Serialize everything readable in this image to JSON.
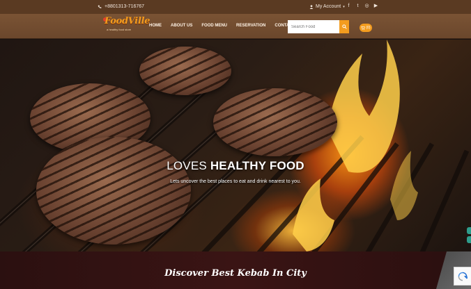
{
  "topbar": {
    "phone": "+8801313-716767",
    "account_label": "My Account",
    "socials": [
      "facebook-icon",
      "twitter-icon",
      "instagram-icon",
      "youtube-icon"
    ]
  },
  "brand": {
    "name": "FoodVille",
    "tagline": "a healthy food store"
  },
  "nav": {
    "items": [
      "HOME",
      "ABOUT US",
      "FOOD MENU",
      "RESERVATION",
      "CONTACT US"
    ]
  },
  "search": {
    "placeholder": "Search Food"
  },
  "cart": {
    "count": "(0)"
  },
  "hero": {
    "title_light": "LOVES ",
    "title_bold": "HEALTHY FOOD",
    "subtitle": "Lets uncover the best places to eat and drink nearest to you."
  },
  "section": {
    "title": "Discover Best Kebab In City"
  },
  "colors": {
    "accent": "#f39c1f",
    "topbar": "#5a3a22",
    "navbar": "#6b472c",
    "band": "#3a1414"
  }
}
